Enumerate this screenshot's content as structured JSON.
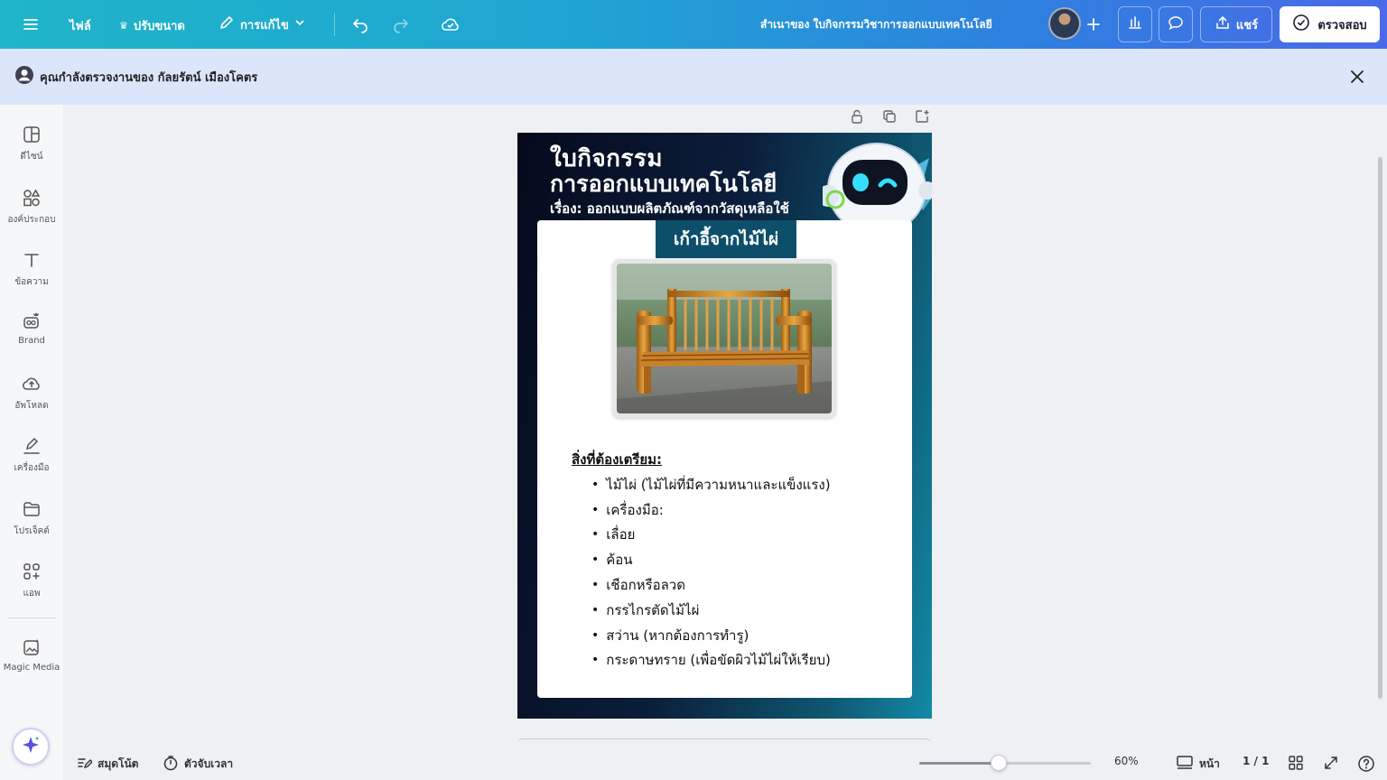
{
  "topbar": {
    "file_label": "ไฟล์",
    "resize_label": "ปรับขนาด",
    "editing_label": "การแก้ไข",
    "doc_title": "สำเนาของ ใบกิจกรรมวิชาการออกแบบเทคโนโลยี",
    "share_label": "แชร์",
    "review_label": "ตรวจสอบ"
  },
  "banner": {
    "text": "คุณกำลังตรวจงานของ กัลยรัตน์ เมืองโคตร"
  },
  "sidebar": {
    "items": [
      {
        "label": "ดีไซน์"
      },
      {
        "label": "องค์ประกอบ"
      },
      {
        "label": "ข้อความ"
      },
      {
        "label": "Brand"
      },
      {
        "label": "อัพโหลด"
      },
      {
        "label": "เครื่องมือ"
      },
      {
        "label": "โปรเจ็คต์"
      },
      {
        "label": "แอพ"
      },
      {
        "label": "Magic Media"
      }
    ]
  },
  "design": {
    "title_line1": "ใบกิจกรรม",
    "title_line2": "การออกแบบเทคโนโลยี",
    "subtitle": "เรื่อง: ออกแบบผลิตภัณฑ์จากวัสดุเหลือใช้",
    "tag": "เก้าอี้จากไม้ไผ่",
    "list_heading": "สิ่งที่ต้องเตรียม:",
    "items": [
      "ไม้ไผ่ (ไม้ไผ่ที่มีความหนาและแข็งแรง)",
      "เครื่องมือ:",
      "เลื่อย",
      "ค้อน",
      "เชือกหรือลวด",
      "กรรไกรตัดไม้ไผ่",
      "สว่าน (หากต้องการทำรู)",
      "กระดาษทราย (เพื่อขัดผิวไม้ไผ่ให้เรียบ)"
    ]
  },
  "bottombar": {
    "notes_label": "สมุดโน้ต",
    "timer_label": "ตัวจับเวลา",
    "zoom_value": 60,
    "zoom_label": "60%",
    "pages_label": "หน้า",
    "page_count": "1 / 1"
  },
  "colors": {
    "accent": "#1fb4c8",
    "banner_bg": "#dbe6fb",
    "design_dark": "#050a1c",
    "design_teal": "#138aa6"
  },
  "icons": [
    "menu-icon",
    "crown-icon",
    "pencil-icon",
    "chevron-down-icon",
    "undo-icon",
    "redo-icon",
    "cloud-check-icon",
    "plus-icon",
    "chart-icon",
    "comment-icon",
    "share-upload-icon",
    "check-circle-icon",
    "user-icon",
    "close-icon",
    "notes-icon",
    "timer-icon",
    "page-view-icon",
    "grid-icon",
    "expand-icon",
    "help-icon",
    "sparkle-icon"
  ]
}
